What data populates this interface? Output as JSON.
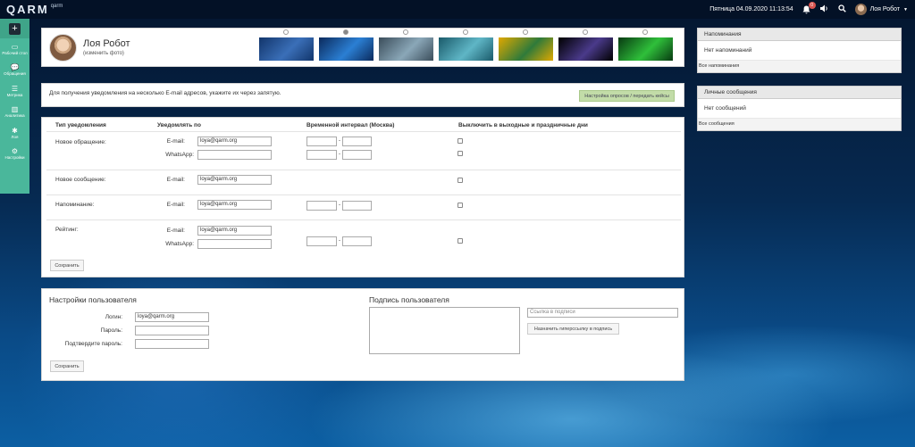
{
  "topbar": {
    "logo": "QARM",
    "logo_sub": "qarm",
    "datetime": "Пятница 04.09.2020 11:13:54",
    "notif_count": "0",
    "user_name": "Лоя Робот",
    "icons": [
      "bell-icon",
      "volume-icon",
      "search-icon"
    ]
  },
  "sidebar": {
    "add_label": "+",
    "items": [
      {
        "icon": "desktop-icon",
        "label": "Рабочий стол",
        "glyph": "▭"
      },
      {
        "icon": "chat-icon",
        "label": "Обращения",
        "glyph": "💬"
      },
      {
        "icon": "list-icon",
        "label": "Метрика",
        "glyph": "☰"
      },
      {
        "icon": "chart-icon",
        "label": "Аналитика",
        "glyph": "▥"
      },
      {
        "icon": "spinner-icon",
        "label": "Лоя",
        "glyph": "✱"
      },
      {
        "icon": "gear-icon",
        "label": "Настройки",
        "glyph": "⚙"
      }
    ]
  },
  "profile": {
    "name": "Лоя Робот",
    "change_photo": "(изменить фото)",
    "themes": [
      {
        "selected": false,
        "colors": [
          "#12356b",
          "#3a6fb8"
        ]
      },
      {
        "selected": true,
        "colors": [
          "#0b2a5c",
          "#2b7fd3"
        ]
      },
      {
        "selected": false,
        "colors": [
          "#3b4d5a",
          "#8aa7b8"
        ]
      },
      {
        "selected": false,
        "colors": [
          "#1a5a6a",
          "#5fb6c6"
        ]
      },
      {
        "selected": false,
        "colors": [
          "#e0a800",
          "#2f7a3a"
        ]
      },
      {
        "selected": false,
        "colors": [
          "#000000",
          "#4a3a8a"
        ]
      },
      {
        "selected": false,
        "colors": [
          "#083a12",
          "#2fbf3a"
        ]
      }
    ]
  },
  "notice": {
    "text": "Для получения уведомления на несколько E-mail адресов, укажите их через запятую.",
    "button": "Настройка опросов / передать кейсы"
  },
  "notifications": {
    "headers": {
      "type": "Тип уведомления",
      "notify_by": "Уведомлять по",
      "interval": "Временной интервал (Москва)",
      "disable": "Выключить в выходные и праздничные дни"
    },
    "email_label": "E-mail:",
    "whatsapp_label": "WhatsApp:",
    "dash": "-",
    "rows": {
      "new_request": "Новое обращение:",
      "new_message": "Новое сообщение:",
      "reminder": "Напоминание:",
      "rating": "Рейтинг:"
    },
    "email_value": "loya@qarm.org",
    "save": "Сохранить"
  },
  "user_settings": {
    "title": "Настройки пользователя",
    "login_label": "Логин:",
    "login_value": "loya@qarm.org",
    "password_label": "Пароль:",
    "confirm_label": "Подтвердите пароль:",
    "save": "Сохранить"
  },
  "signature": {
    "title": "Подпись пользователя",
    "link_placeholder": "Ссылка в подписи",
    "link_button": "Назначить гиперссылку в подпись"
  },
  "reminders": {
    "title": "Напоминания",
    "empty": "Нет напоминаний",
    "all": "Все напоминания"
  },
  "messages": {
    "title": "Личные сообщения",
    "empty": "Нет сообщений",
    "all": "Все сообщения"
  }
}
